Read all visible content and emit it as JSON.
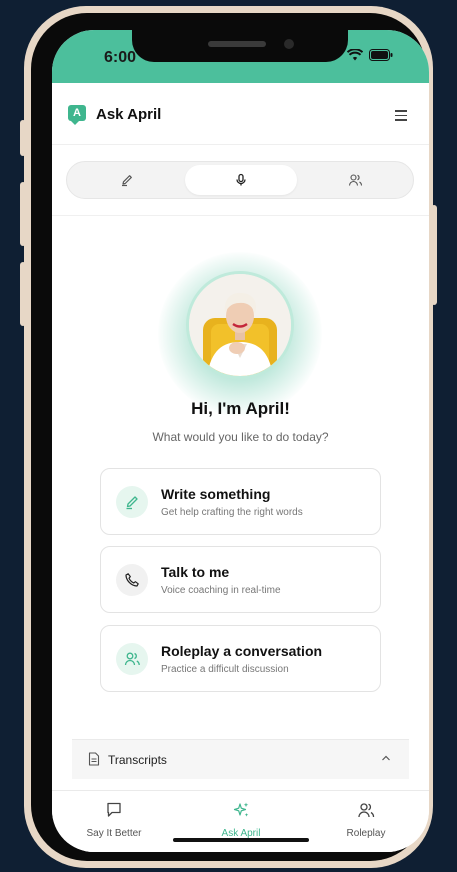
{
  "status": {
    "time": "6:00"
  },
  "app": {
    "title": "Ask April",
    "logo_letter": "A"
  },
  "modes": [
    {
      "name": "write",
      "icon": "pencil-icon"
    },
    {
      "name": "voice",
      "icon": "microphone-icon",
      "selected": true
    },
    {
      "name": "roleplay",
      "icon": "users-icon"
    }
  ],
  "hero": {
    "greeting": "Hi, I'm April!",
    "prompt": "What would you like to do today?"
  },
  "actions": [
    {
      "title": "Write something",
      "desc": "Get help crafting the right words",
      "icon": "pencil-icon"
    },
    {
      "title": "Talk to me",
      "desc": "Voice coaching in real-time",
      "icon": "phone-icon"
    },
    {
      "title": "Roleplay a conversation",
      "desc": "Practice a difficult discussion",
      "icon": "users-icon"
    }
  ],
  "transcripts": {
    "label": "Transcripts"
  },
  "tabs": [
    {
      "label": "Say It Better",
      "icon": "chat-bubble-icon"
    },
    {
      "label": "Ask April",
      "icon": "sparkles-icon",
      "active": true
    },
    {
      "label": "Roleplay",
      "icon": "users-icon"
    }
  ],
  "colors": {
    "accent": "#4cbf9c",
    "background": "#0f1f33"
  }
}
